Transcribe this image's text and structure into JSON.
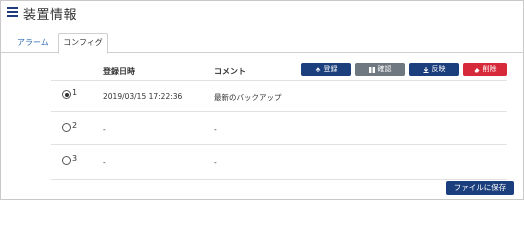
{
  "header": {
    "title": "装置情報",
    "menu_icon": "hamburger-menu-icon"
  },
  "tabs": [
    {
      "label": "アラーム",
      "active": false
    },
    {
      "label": "コンフィグ",
      "active": true
    }
  ],
  "table": {
    "columns": [
      "登録日時",
      "コメント"
    ],
    "rows": [
      {
        "num": "1",
        "selected": true,
        "date": "2019/03/15 17:22:36",
        "comment": "最新のバックアップ"
      },
      {
        "num": "2",
        "selected": false,
        "date": "-",
        "comment": "-"
      },
      {
        "num": "3",
        "selected": false,
        "date": "-",
        "comment": "-"
      }
    ]
  },
  "toolbar": {
    "register_label": "登録",
    "confirm_label": "確認",
    "reflect_label": "反映",
    "delete_label": "削除"
  },
  "footer": {
    "save_label": "ファイルに保存"
  },
  "colors": {
    "primary": "#1b3f7d",
    "secondary": "#6f7780",
    "danger": "#d6293a",
    "link": "#2d6bb3"
  }
}
